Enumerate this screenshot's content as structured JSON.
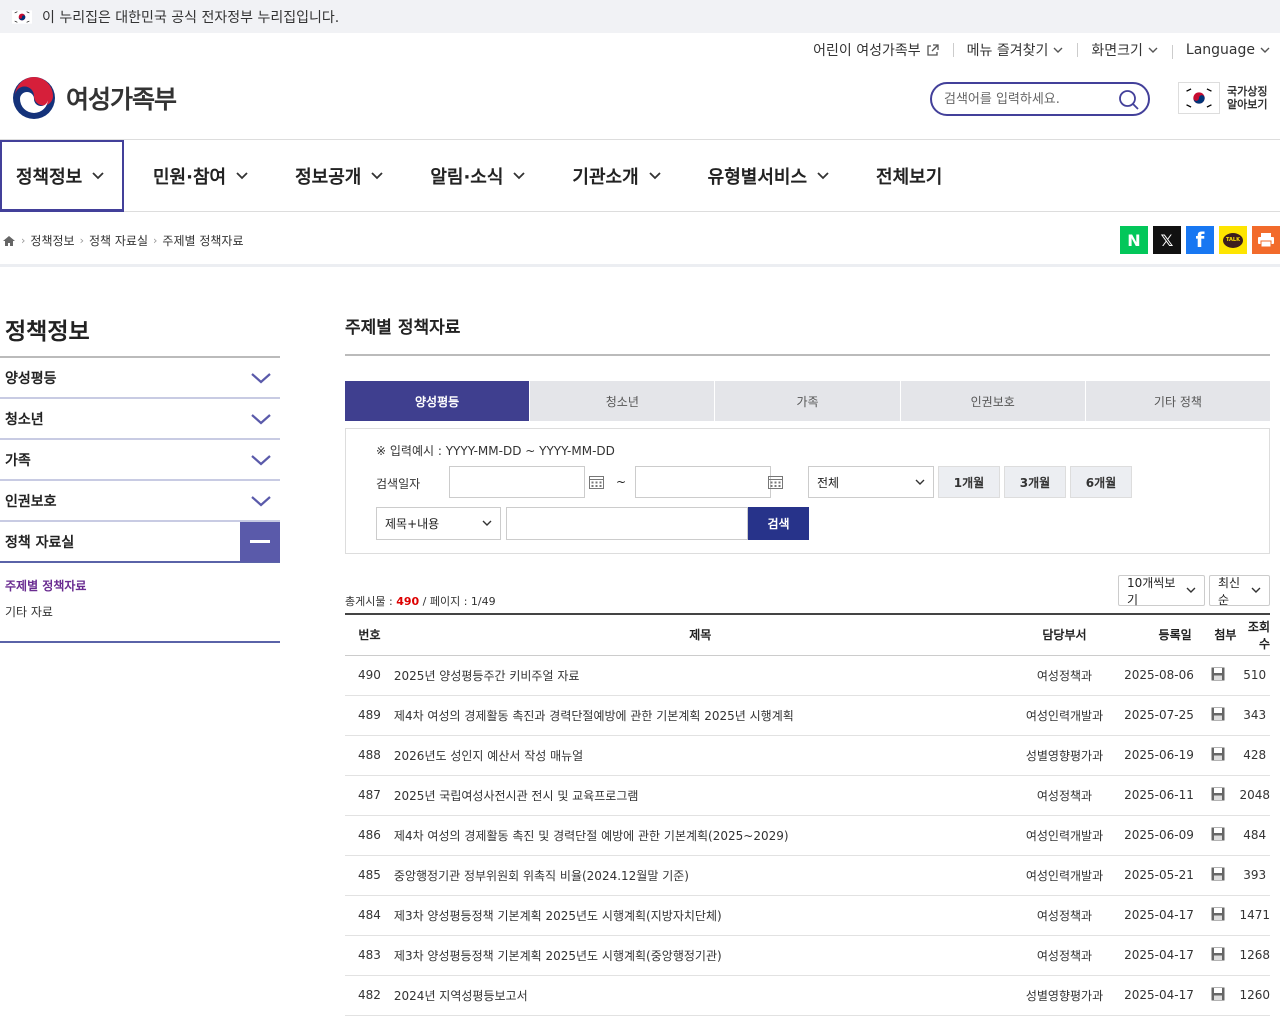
{
  "gov_banner": {
    "text": "이 누리집은 대한민국 공식 전자정부 누리집입니다."
  },
  "util_links": [
    {
      "label": "어린이 여성가족부",
      "icon": "external-link-icon"
    },
    {
      "label": "메뉴 즐겨찾기",
      "icon": "chevron-down-icon"
    },
    {
      "label": "화면크기",
      "icon": "chevron-down-icon"
    },
    {
      "label": "Language",
      "icon": "chevron-down-icon"
    }
  ],
  "logo": {
    "text": "여성가족부"
  },
  "search": {
    "placeholder": "검색어를 입력하세요."
  },
  "national_symbol": {
    "line1": "국가상징",
    "line2": "알아보기"
  },
  "gnb": [
    {
      "label": "정책정보",
      "active": true
    },
    {
      "label": "민원·참여"
    },
    {
      "label": "정보공개"
    },
    {
      "label": "알림·소식"
    },
    {
      "label": "기관소개"
    },
    {
      "label": "유형별서비스"
    },
    {
      "label": "전체보기"
    }
  ],
  "breadcrumb": [
    "정책정보",
    "정책 자료실",
    "주제별 정책자료"
  ],
  "share": [
    {
      "name": "naver",
      "color": "#03c75a",
      "glyph": "N"
    },
    {
      "name": "x",
      "color": "#111111",
      "glyph": "𝕏"
    },
    {
      "name": "facebook",
      "color": "#1877f2",
      "glyph": "f"
    },
    {
      "name": "kakaotalk",
      "color": "#fee500",
      "glyph": "TALK"
    },
    {
      "name": "print",
      "color": "#f26b2b",
      "glyph": ""
    }
  ],
  "lnb": {
    "title": "정책정보",
    "items": [
      "양성평등",
      "청소년",
      "가족",
      "인권보호",
      "정책 자료실"
    ],
    "sub": [
      "주제별 정책자료",
      "기타 자료"
    ]
  },
  "content": {
    "title": "주제별 정책자료",
    "tabs": [
      "양성평등",
      "청소년",
      "가족",
      "인권보호",
      "기타 정책"
    ],
    "filter": {
      "example": "※ 입력예시 : YYYY-MM-DD ~ YYYY-MM-DD",
      "date_label": "검색일자",
      "tilde": "~",
      "range_select": "전체",
      "period_buttons": [
        "1개월",
        "3개월",
        "6개월"
      ],
      "field_select": "제목+내용",
      "search_button": "검색"
    },
    "total": {
      "label": "총게시물 : ",
      "count": "490",
      "page_label": " / 페이지 : 1/49"
    },
    "per_page": "10개씩보기",
    "sort": "최신순",
    "columns": [
      "번호",
      "제목",
      "담당부서",
      "등록일",
      "첨부",
      "조회수"
    ],
    "rows": [
      {
        "no": "490",
        "title": "2025년 양성평등주간 키비주얼 자료",
        "dept": "여성정책과",
        "date": "2025-08-06",
        "views": "510"
      },
      {
        "no": "489",
        "title": "제4차 여성의 경제활동 촉진과 경력단절예방에 관한 기본계획 2025년 시행계획",
        "dept": "여성인력개발과",
        "date": "2025-07-25",
        "views": "343"
      },
      {
        "no": "488",
        "title": "2026년도 성인지 예산서 작성 매뉴얼",
        "dept": "성별영향평가과",
        "date": "2025-06-19",
        "views": "428"
      },
      {
        "no": "487",
        "title": "2025년 국립여성사전시관 전시 및 교육프로그램",
        "dept": "여성정책과",
        "date": "2025-06-11",
        "views": "2048"
      },
      {
        "no": "486",
        "title": "제4차 여성의 경제활동 촉진 및 경력단절 예방에 관한 기본계획(2025~2029)",
        "dept": "여성인력개발과",
        "date": "2025-06-09",
        "views": "484"
      },
      {
        "no": "485",
        "title": "중앙행정기관 정부위원회 위촉직 비율(2024.12월말 기준)",
        "dept": "여성인력개발과",
        "date": "2025-05-21",
        "views": "393"
      },
      {
        "no": "484",
        "title": "제3차 양성평등정책 기본계획 2025년도 시행계획(지방자치단체)",
        "dept": "여성정책과",
        "date": "2025-04-17",
        "views": "1471"
      },
      {
        "no": "483",
        "title": "제3차 양성평등정책 기본계획 2025년도 시행계획(중앙행정기관)",
        "dept": "여성정책과",
        "date": "2025-04-17",
        "views": "1268"
      },
      {
        "no": "482",
        "title": "2024년 지역성평등보고서",
        "dept": "성별영향평가과",
        "date": "2025-04-17",
        "views": "1260"
      }
    ]
  }
}
